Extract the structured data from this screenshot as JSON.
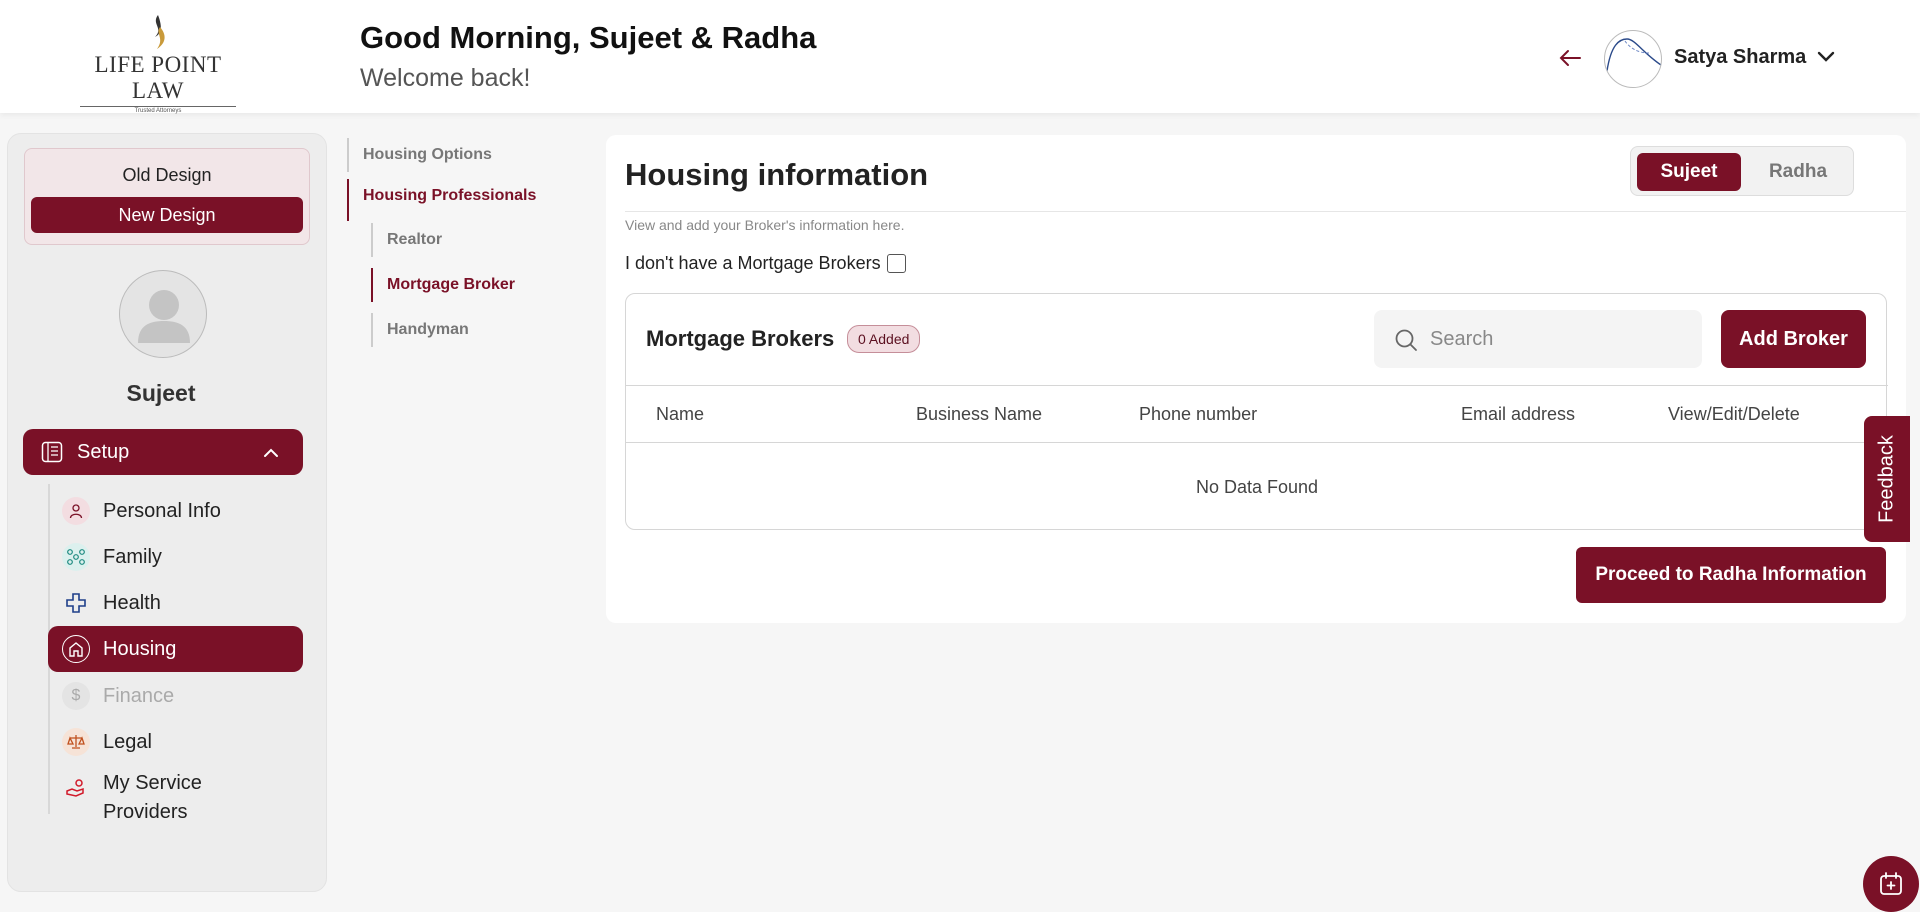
{
  "brand": {
    "name": "LIFE POINT LAW",
    "tagline": "Trusted Attorneys"
  },
  "header": {
    "greeting": "Good Morning, Sujeet & Radha",
    "subtitle": "Welcome back!",
    "user_name": "Satya Sharma"
  },
  "sidebar": {
    "old_design": "Old Design",
    "new_design": "New Design",
    "profile_name": "Sujeet",
    "setup_label": "Setup",
    "items": [
      {
        "label": "Personal Info",
        "icon": "person-icon"
      },
      {
        "label": "Family",
        "icon": "family-icon"
      },
      {
        "label": "Health",
        "icon": "health-cross-icon"
      },
      {
        "label": "Housing",
        "icon": "home-icon",
        "active": true
      },
      {
        "label": "Finance",
        "icon": "dollar-icon",
        "disabled": true
      },
      {
        "label": "Legal",
        "icon": "scales-icon"
      },
      {
        "label": "My Service Providers",
        "icon": "service-provider-icon"
      }
    ]
  },
  "subnav": {
    "housing_options": "Housing Options",
    "housing_professionals": "Housing Professionals",
    "realtor": "Realtor",
    "mortgage_broker": "Mortgage Broker",
    "handyman": "Handyman"
  },
  "main": {
    "title": "Housing information",
    "tabs": [
      "Sujeet",
      "Radha"
    ],
    "hint": "View and add your Broker's information here.",
    "no_checkbox_label": "I don't have a Mortgage Brokers",
    "table_title": "Mortgage Brokers",
    "badge": "0 Added",
    "search_placeholder": "Search",
    "add_button": "Add Broker",
    "columns": [
      "Name",
      "Business Name",
      "Phone number",
      "Email address",
      "View/Edit/Delete"
    ],
    "empty": "No Data Found",
    "proceed_button": "Proceed to Radha Information"
  },
  "feedback": "Feedback",
  "colors": {
    "accent": "#7a1127",
    "gold": "#c99a3a"
  }
}
